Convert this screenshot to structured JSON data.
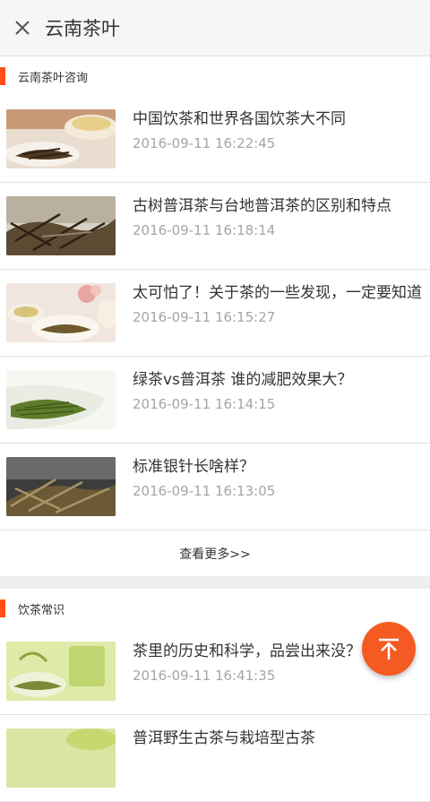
{
  "header": {
    "title": "云南茶叶"
  },
  "sections": [
    {
      "title": "云南茶叶咨询",
      "more_label": "查看更多>>",
      "articles": [
        {
          "title": "中国饮茶和世界各国饮茶大不同",
          "date": "2016-09-11 16:22:45",
          "thumb_icon": "tea-cups-photo"
        },
        {
          "title": "古树普洱茶与台地普洱茶的区别和特点",
          "date": "2016-09-11 16:18:14",
          "thumb_icon": "tea-leaves-photo"
        },
        {
          "title": "太可怕了！关于茶的一些发现，一定要知道",
          "date": "2016-09-11 16:15:27",
          "thumb_icon": "tea-bowls-photo"
        },
        {
          "title": "绿茶vs普洱茶 谁的减肥效果大？",
          "date": "2016-09-11 16:14:15",
          "thumb_icon": "green-tea-photo"
        },
        {
          "title": "标准银针长啥样？",
          "date": "2016-09-11 16:13:05",
          "thumb_icon": "silver-needle-photo"
        }
      ]
    },
    {
      "title": "饮茶常识",
      "articles": [
        {
          "title": "茶里的历史和科学，品尝出来没？",
          "date": "2016-09-11 16:41:35",
          "thumb_icon": "tea-glass-photo"
        },
        {
          "title": "普洱野生古茶与栽培型古茶",
          "date": "",
          "thumb_icon": "tea-photo"
        }
      ]
    }
  ],
  "colors": {
    "accent": "#ff4f17",
    "fab": "#f55a22",
    "date": "#a5a5a5"
  },
  "fab_icon": "back-to-top-icon"
}
